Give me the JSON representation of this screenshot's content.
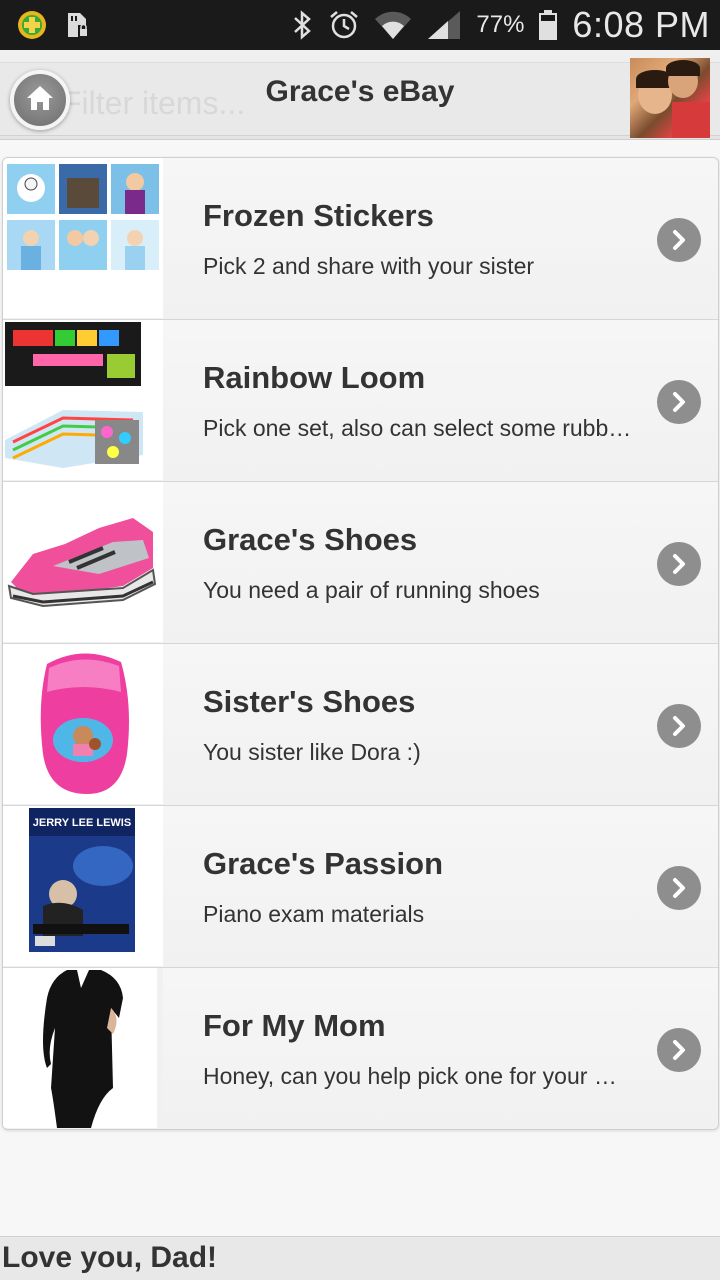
{
  "status_bar": {
    "battery_percent": "77%",
    "time": "6:08 PM",
    "icons": [
      "app-plus-icon",
      "sd-card-icon",
      "bluetooth-icon",
      "alarm-icon",
      "wifi-icon",
      "signal-icon",
      "battery-icon"
    ]
  },
  "header": {
    "title": "Grace's eBay",
    "filter_placeholder": "Filter items...",
    "home_icon": "home-icon"
  },
  "items": [
    {
      "title": "Frozen Stickers",
      "description": "Pick 2 and share with your sister"
    },
    {
      "title": "Rainbow Loom",
      "description": "Pick one set, also can select some rubber bands"
    },
    {
      "title": "Grace's Shoes",
      "description": "You need a pair of running shoes"
    },
    {
      "title": "Sister's Shoes",
      "description": "You sister like Dora :)"
    },
    {
      "title": "Grace's Passion",
      "description": "Piano exam materials"
    },
    {
      "title": "For My Mom",
      "description": "Honey, can you help pick one for your mom"
    }
  ],
  "thumbnails": {
    "dvd_text": "JERRY LEE LEWIS"
  },
  "footer": {
    "text": "Love you, Dad!"
  },
  "colors": {
    "status_bar_bg": "#1a1a1a",
    "header_bg": "#e9e9e9",
    "list_bg": "#f4f4f4",
    "chevron_bg": "#8e8e8e",
    "text": "#333333"
  }
}
